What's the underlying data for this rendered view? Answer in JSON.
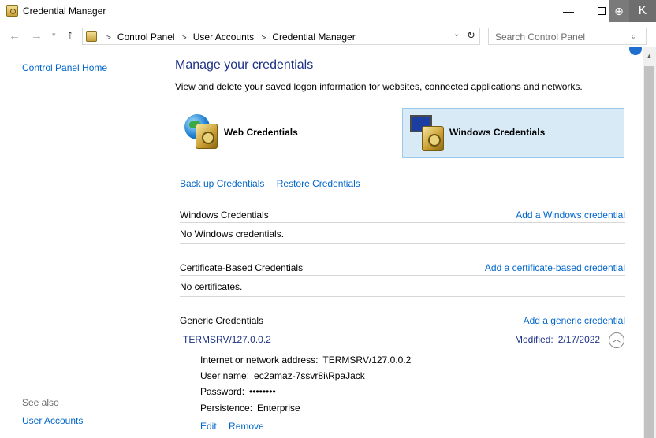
{
  "window": {
    "title": "Credential Manager",
    "minimize_glyph": "—",
    "zoom_glyph": "⊕",
    "close_glyph": "K"
  },
  "nav": {
    "back_glyph": "←",
    "forward_glyph": "→",
    "recent_glyph": "▾",
    "up_glyph": "↑",
    "breadcrumbs": [
      "Control Panel",
      "User Accounts",
      "Credential Manager"
    ],
    "crumb_sep": ">",
    "dropdown_glyph": "⌄",
    "refresh_glyph": "↻",
    "search_placeholder": "Search Control Panel",
    "search_glyph": "⌕"
  },
  "sidebar": {
    "home_link": "Control Panel Home",
    "see_also": "See also",
    "user_accounts_link": "User Accounts"
  },
  "main": {
    "title": "Manage your credentials",
    "description": "View and delete your saved logon information for websites, connected applications and networks.",
    "tiles": {
      "web": "Web Credentials",
      "windows": "Windows Credentials"
    },
    "backup_link": "Back up Credentials",
    "restore_link": "Restore Credentials",
    "sections": {
      "windows": {
        "title": "Windows Credentials",
        "add_link": "Add a Windows credential",
        "body": "No Windows credentials."
      },
      "certificate": {
        "title": "Certificate-Based Credentials",
        "add_link": "Add a certificate-based credential",
        "body": "No certificates."
      },
      "generic": {
        "title": "Generic Credentials",
        "add_link": "Add a generic credential"
      }
    },
    "credential": {
      "name": "TERMSRV/127.0.0.2",
      "modified_label": "Modified:",
      "modified_value": "2/17/2022",
      "collapse_glyph": "︿",
      "address_label": "Internet or network address:",
      "address_value": "TERMSRV/127.0.0.2",
      "username_label": "User name:",
      "username_value": "ec2amaz-7ssvr8i\\RpaJack",
      "password_label": "Password:",
      "password_value": "••••••••",
      "persistence_label": "Persistence:",
      "persistence_value": "Enterprise",
      "edit_link": "Edit",
      "remove_link": "Remove"
    }
  },
  "colors": {
    "link": "#0066cc",
    "heading": "#1e3287",
    "tile_selected_bg": "#d9eaf7",
    "tile_selected_border": "#99c9ef"
  }
}
